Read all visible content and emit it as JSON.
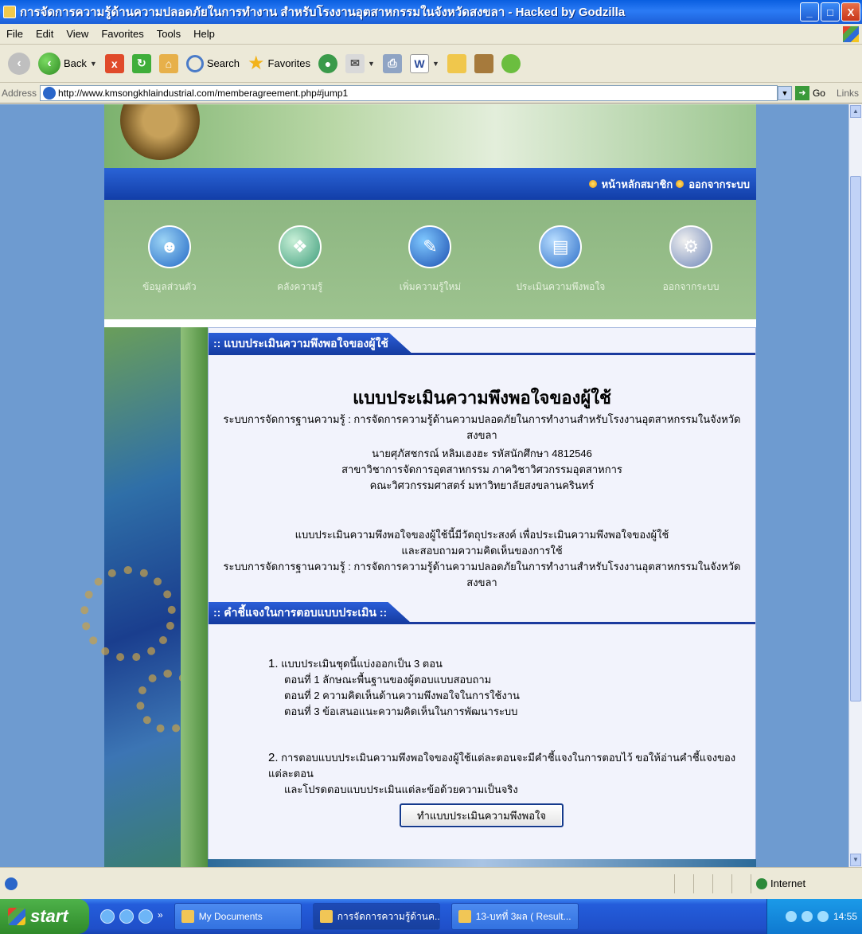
{
  "window": {
    "title": "การจัดการความรู้ด้านความปลอดภัยในการทำงาน สำหรับโรงงานอุตสาหกรรมในจังหวัดสงขลา - Hacked by Godzilla",
    "controls": {
      "minimize": "_",
      "maximize": "□",
      "close": "X"
    }
  },
  "menu": [
    "File",
    "Edit",
    "View",
    "Favorites",
    "Tools",
    "Help"
  ],
  "toolbar": {
    "back": "Back",
    "search": "Search",
    "favorites": "Favorites"
  },
  "address": {
    "label": "Address",
    "url": "http://www.kmsongkhlaindustrial.com/memberagreement.php#jump1",
    "go": "Go",
    "links": "Links"
  },
  "nav": {
    "member_home": "หน้าหลักสมาชิก",
    "logout": "ออกจากระบบ"
  },
  "icons": [
    {
      "label": "ข้อมูลส่วนตัว"
    },
    {
      "label": "คลังความรู้"
    },
    {
      "label": "เพิ่มความรู้ใหม่"
    },
    {
      "label": "ประเมินความพึงพอใจ"
    },
    {
      "label": "ออกจากระบบ"
    }
  ],
  "section1": {
    "header": ":: แบบประเมินความพึงพอใจของผู้ใช้"
  },
  "intro": {
    "title": "แบบประเมินความพึงพอใจของผู้ใช้",
    "system_line": "ระบบการจัดการฐานความรู้ : การจัดการความรู้ด้านความปลอดภัยในการทำงานสำหรับโรงงานอุตสาหกรรมในจังหวัดสงขลา",
    "author_name": "นายศุภัสชกรณ์ หลิมเฮงฮะ รหัสนักศึกษา 4812546",
    "author_dept": "สาขาวิชาการจัดการอุตสาหกรรม ภาควิชาวิศวกรรมอุตสาหการ",
    "author_faculty": "คณะวิศวกรรมศาสตร์ มหาวิทยาลัยสงขลานครินทร์",
    "purpose_1": "แบบประเมินความพึงพอใจของผู้ใช้นี้มีวัตถุประสงค์ เพื่อประเมินความพึงพอใจของผู้ใช้",
    "purpose_2": "และสอบถามความคิดเห็นของการใช้",
    "purpose_3": "ระบบการจัดการฐานความรู้ : การจัดการความรู้ด้านความปลอดภัยในการทำงานสำหรับโรงงานอุตสาหกรรมในจังหวัดสงขลา"
  },
  "section2": {
    "header": ":: คำชี้แจงในการตอบแบบประเมิน ::"
  },
  "instructions": {
    "item1_num": "1.",
    "item1": "แบบประเมินชุดนี้แบ่งออกเป็น 3 ตอน",
    "part1": "ตอนที่ 1 ลักษณะพื้นฐานของผู้ตอบแบบสอบถาม",
    "part2": "ตอนที่ 2 ความคิดเห็นด้านความพึงพอใจในการใช้งาน",
    "part3": "ตอนที่ 3 ข้อเสนอแนะความคิดเห็นในการพัฒนาระบบ",
    "item2_num": "2.",
    "item2_a": "การตอบแบบประเมินความพึงพอใจของผู้ใช้แต่ละตอนจะมีคำชี้แจงในการตอบไว้ ขอให้อ่านคำชี้แจงของแต่ละตอน",
    "item2_b": "และโปรดตอบแบบประเมินแต่ละข้อด้วยความเป็นจริง"
  },
  "button": {
    "start_assessment": "ทำแบบประเมินความพึงพอใจ"
  },
  "status": {
    "zone": "Internet"
  },
  "taskbar": {
    "start": "start",
    "tasks": [
      "My Documents",
      "การจัดการความรู้ด้านค...",
      "13-บทที่ 3ผล ( Result..."
    ],
    "clock": "14:55"
  }
}
